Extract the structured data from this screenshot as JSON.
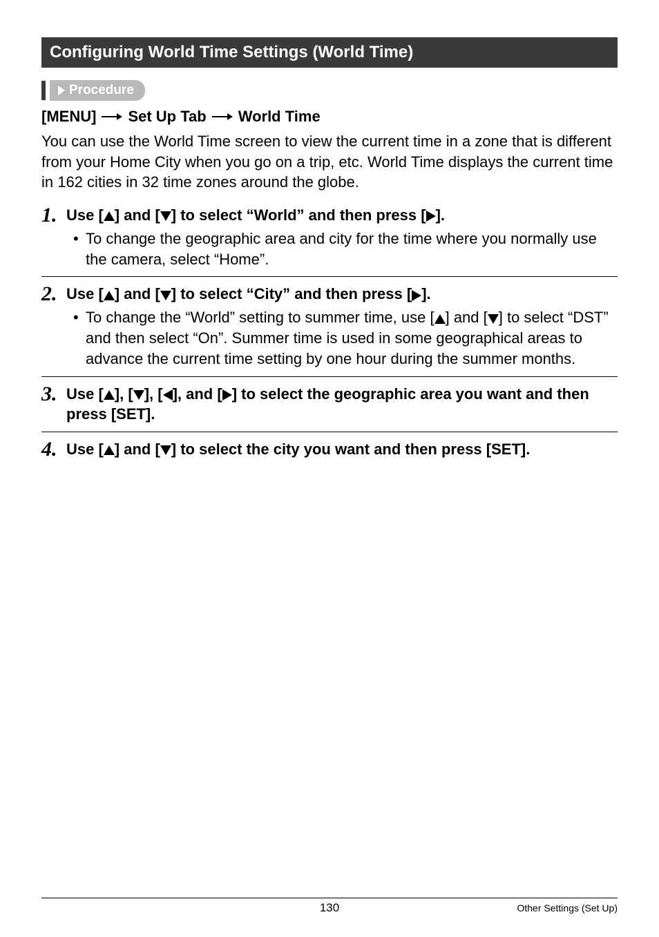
{
  "section": {
    "title": "Configuring World Time Settings (World Time)"
  },
  "procedure_label": "Procedure",
  "menupath": {
    "p1": "[MENU]",
    "p2": "Set Up Tab",
    "p3": "World Time"
  },
  "intro": "You can use the World Time screen to view the current time in a zone that is different from your Home City when you go on a trip, etc. World Time displays the current time in 162 cities in 32 time zones around the globe.",
  "steps": [
    {
      "num": "1.",
      "pre": "Use [",
      "mid1": "] and [",
      "mid2": "] to select “World” and then press [",
      "post": "].",
      "bullets": [
        "To change the geographic area and city for the time where you normally use the camera, select “Home”."
      ]
    },
    {
      "num": "2.",
      "pre": "Use [",
      "mid1": "] and [",
      "mid2": "] to select “City” and then press [",
      "post": "].",
      "bullets_rich": {
        "a": "To change the “World” setting to summer time, use [",
        "b": "] and [",
        "c": "] to select “DST” and then select “On”. Summer time is used in some geographical areas to advance the current time setting by one hour during the summer months."
      }
    },
    {
      "num": "3.",
      "pre": "Use [",
      "j1": "], [",
      "j2": "], [",
      "j3": "], and [",
      "post": "] to select the geographic area you want and then press [SET]."
    },
    {
      "num": "4.",
      "pre": "Use [",
      "mid1": "] and [",
      "post": "] to select the city you want and then press [SET]."
    }
  ],
  "footer": {
    "page": "130",
    "right": "Other Settings (Set Up)"
  }
}
